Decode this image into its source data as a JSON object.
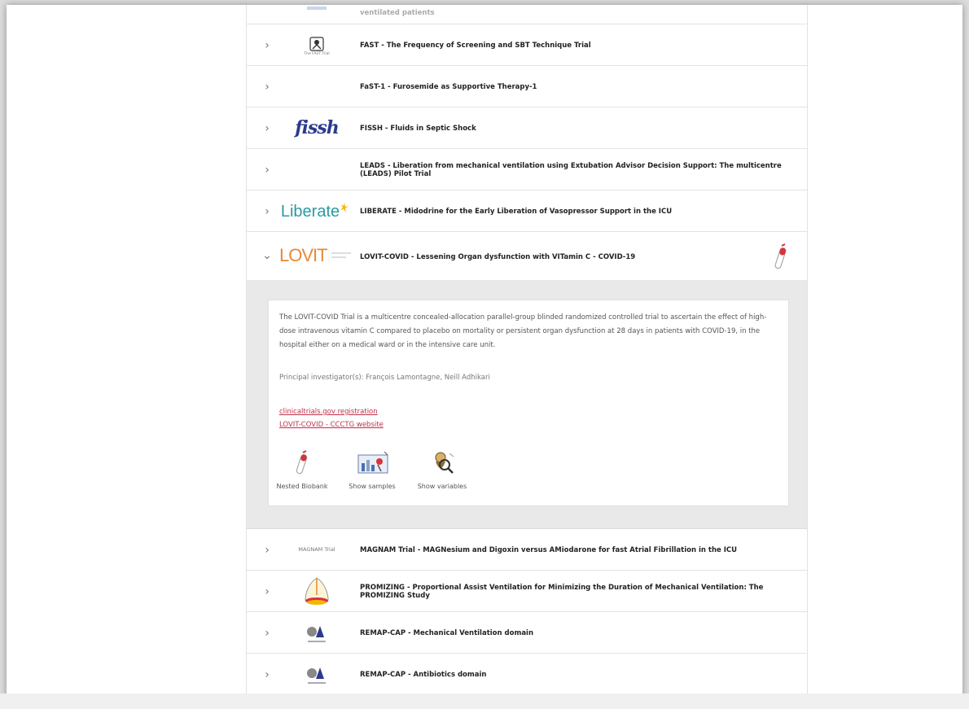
{
  "trials": [
    {
      "id": "vent",
      "title": "ventilated patients",
      "logo": "",
      "expanded": false
    },
    {
      "id": "fast",
      "title": "FAST - The Frequency of Screening and SBT Technique Trial",
      "logo": "The FAST Trial",
      "expanded": false
    },
    {
      "id": "fast1",
      "title": "FaST-1 - Furosemide as Supportive Therapy-1",
      "logo": "",
      "expanded": false
    },
    {
      "id": "fissh",
      "title": "FISSH - Fluids in Septic Shock",
      "logo": "fissh",
      "expanded": false
    },
    {
      "id": "leads",
      "title": "LEADS - Liberation from mechanical ventilation using Extubation Advisor Decision Support: The multicentre (LEADS) Pilot Trial",
      "logo": "",
      "expanded": false
    },
    {
      "id": "liberate",
      "title": "LIBERATE - Midodrine for the Early Liberation of Vasopressor Support in the ICU",
      "logo": "Liberate",
      "expanded": false
    },
    {
      "id": "lovit",
      "title": "LOVIT-COVID - Lessening Organ dysfunction with VITamin C - COVID-19",
      "logo": "LOVIT",
      "expanded": true
    },
    {
      "id": "magnam",
      "title": "MAGNAM Trial - MAGNesium and Digoxin versus AMiodarone for fast Atrial Fibrillation in the ICU",
      "logo": "MAGNAM Trial",
      "expanded": false
    },
    {
      "id": "promizing",
      "title": "PROMIZING - Proportional Assist Ventilation for Minimizing the Duration of Mechanical Ventilation: The PROMIZING Study",
      "logo": "",
      "expanded": false
    },
    {
      "id": "remap_mv",
      "title": "REMAP-CAP - Mechanical Ventilation domain",
      "logo": "",
      "expanded": false
    },
    {
      "id": "remap_ab",
      "title": "REMAP-CAP - Antibiotics domain",
      "logo": "",
      "expanded": false
    }
  ],
  "detail": {
    "description": "The LOVIT-COVID Trial is a multicentre concealed-allocation parallel-group blinded randomized controlled trial to ascertain the effect of high-dose intravenous vitamin C compared to placebo on mortality or persistent organ dysfunction at 28 days in patients with COVID-19, in the hospital either on a medical ward or in the intensive care unit.",
    "pi": "Principal investigator(s): François Lamontagne, Neill Adhikari",
    "link1": "clinicaltrials.gov registration",
    "link2": "LOVIT-COVID - CCCTG website",
    "actions": {
      "biobank": "Nested Biobank",
      "samples": "Show samples",
      "variables": "Show variables"
    }
  },
  "icons": {
    "collapsed": "chevron-right-icon",
    "expanded": "chevron-down-icon",
    "biobank": "test-tube-icon",
    "samples": "sample-chart-icon",
    "variables": "magnifier-figure-icon"
  },
  "colors": {
    "link": "#c0304a",
    "liberate": "#2a9aa0",
    "lovit": "#e58a3a",
    "fissh": "#2b3a8f"
  }
}
